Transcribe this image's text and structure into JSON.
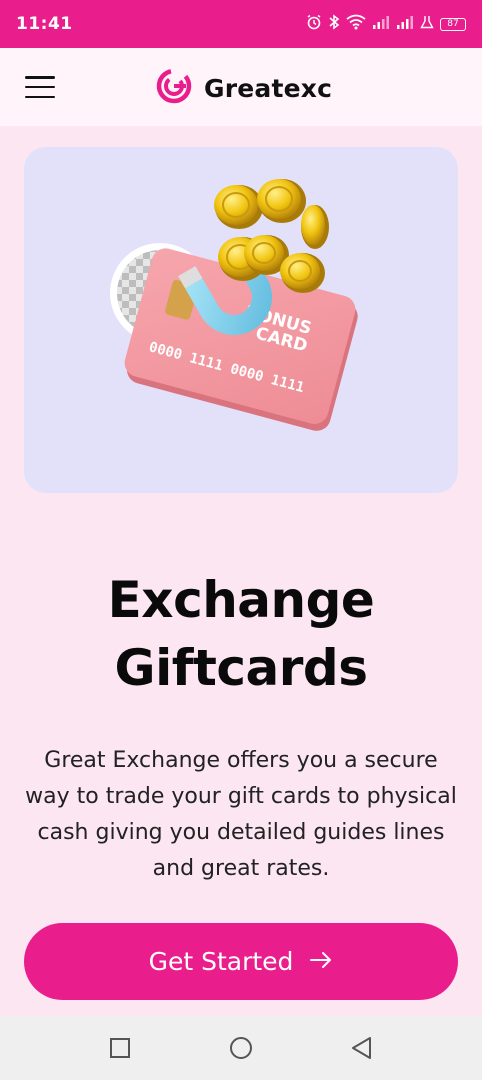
{
  "status_bar": {
    "time": "11:41",
    "battery": "87",
    "icons": [
      "alarm-icon",
      "bluetooth-icon",
      "wifi-icon",
      "signal-icon",
      "signal-icon",
      "lab-icon",
      "battery-icon"
    ],
    "accent_color": "#e91e8c"
  },
  "header": {
    "brand_name": "Greatexc",
    "menu_icon": "hamburger-menu-icon",
    "logo_icon": "greatexc-logo-icon"
  },
  "hero": {
    "card_text_line1": "BONUS",
    "card_text_line2": "CARD",
    "card_number": "0000 1111 0000 1111",
    "title_line1": "Exchange",
    "title_line2": "Giftcards",
    "description": "Great Exchange offers you a secure way to trade your gift cards to physical cash giving you detailed guides lines and great rates."
  },
  "cta": {
    "label": "Get Started",
    "icon": "arrow-right-icon"
  },
  "nav": {
    "icons": [
      "square-recents-icon",
      "circle-home-icon",
      "triangle-back-icon"
    ]
  },
  "colors": {
    "brand": "#e91e8c",
    "background": "#fce6f1",
    "hero_bg": "#e3e0fa"
  }
}
